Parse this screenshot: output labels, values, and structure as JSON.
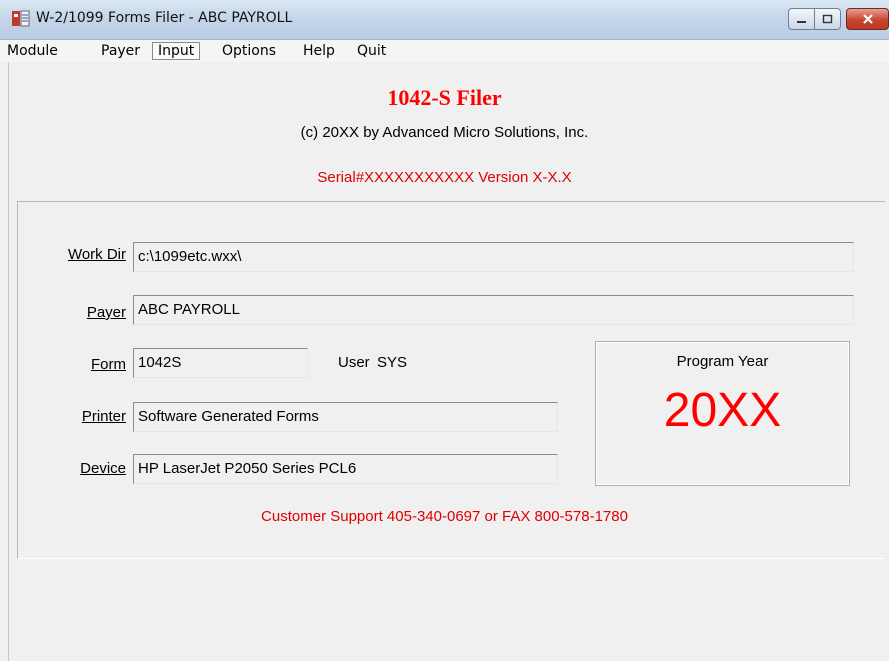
{
  "window": {
    "title": "W-2/1099 Forms Filer - ABC PAYROLL"
  },
  "menu": {
    "items": [
      {
        "label": "Module"
      },
      {
        "label": "Payer"
      },
      {
        "label": "Input"
      },
      {
        "label": "Options"
      },
      {
        "label": "Help"
      },
      {
        "label": "Quit"
      }
    ]
  },
  "header": {
    "title": "1042-S Filer",
    "copyright": "(c) 20XX by Advanced Micro Solutions, Inc.",
    "serial": "Serial#XXXXXXXXXXX    Version X-X.X"
  },
  "form": {
    "work_dir": {
      "label": "Work Dir",
      "value": "c:\\1099etc.wxx\\"
    },
    "payer": {
      "label": "Payer",
      "value": "ABC PAYROLL"
    },
    "form": {
      "label": "Form",
      "value": "1042S"
    },
    "user": {
      "label": "User",
      "value": "SYS"
    },
    "printer": {
      "label": "Printer",
      "value": "Software Generated Forms"
    },
    "device": {
      "label": "Device",
      "value": "HP LaserJet P2050 Series PCL6"
    }
  },
  "program_year": {
    "label": "Program Year",
    "value": "20XX"
  },
  "footer": {
    "support": "Customer Support 405-340-0697  or  FAX 800-578-1780"
  },
  "colors": {
    "accent_red": "#ff0000",
    "titlebar": "#c5d6ea",
    "background": "#f0f0f0"
  }
}
